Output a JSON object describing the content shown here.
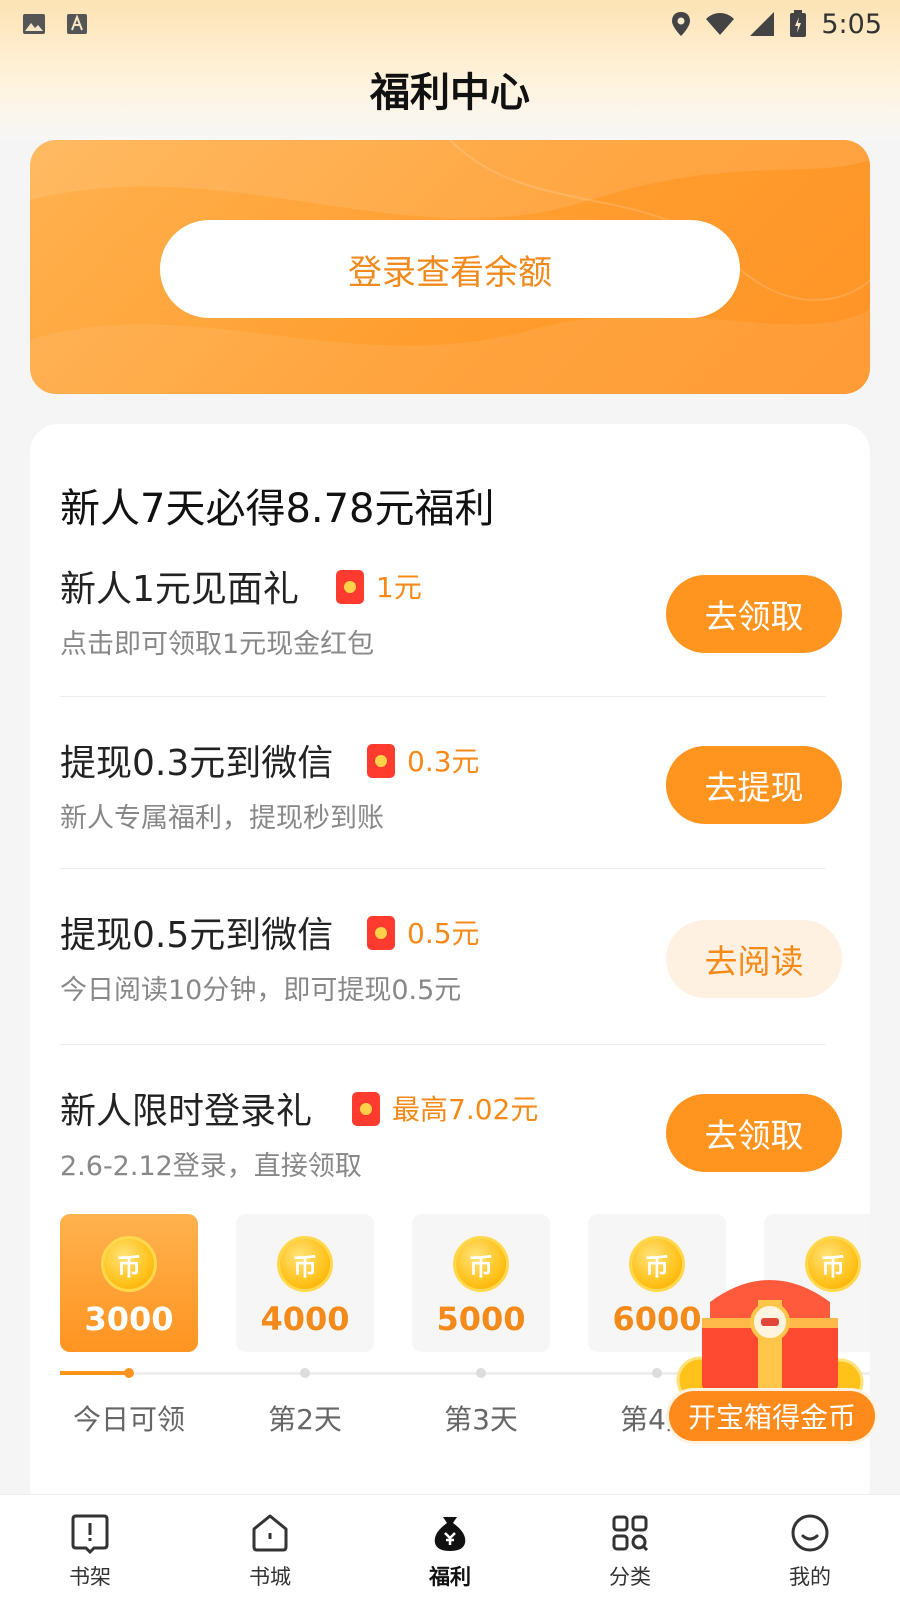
{
  "status_bar": {
    "time": "5:05"
  },
  "header": {
    "title": "福利中心"
  },
  "balance": {
    "login_button": "登录查看余额"
  },
  "welfare": {
    "title": "新人7天必得8.78元福利",
    "tasks": [
      {
        "name": "新人1元见面礼",
        "reward": "1元",
        "desc": "点击即可领取1元现金红包",
        "button": "去领取"
      },
      {
        "name": "提现0.3元到微信",
        "reward": "0.3元",
        "desc": "新人专属福利，提现秒到账",
        "button": "去提现"
      },
      {
        "name": "提现0.5元到微信",
        "reward": "0.5元",
        "desc": "今日阅读10分钟，即可提现0.5元",
        "button": "去阅读"
      },
      {
        "name": "新人限时登录礼",
        "reward": "最高7.02元",
        "desc": "2.6-2.12登录，直接领取",
        "button": "去领取"
      }
    ],
    "coin_glyph": "币",
    "days": [
      {
        "amount": "3000",
        "label": "今日可领"
      },
      {
        "amount": "4000",
        "label": "第2天"
      },
      {
        "amount": "5000",
        "label": "第3天"
      },
      {
        "amount": "6000",
        "label": "第4天"
      },
      {
        "amount": "",
        "label": ""
      }
    ]
  },
  "treasure": {
    "label": "开宝箱得金币"
  },
  "tabbar": {
    "items": [
      {
        "label": "书架",
        "icon": "bookshelf-icon"
      },
      {
        "label": "书城",
        "icon": "bookstore-icon"
      },
      {
        "label": "福利",
        "icon": "money-bag-icon"
      },
      {
        "label": "分类",
        "icon": "category-icon"
      },
      {
        "label": "我的",
        "icon": "profile-icon"
      }
    ],
    "active": "福利"
  },
  "colors": {
    "accent": "#ff941f",
    "accent_text": "#f48a1a",
    "envelope": "#ff3b2f"
  }
}
